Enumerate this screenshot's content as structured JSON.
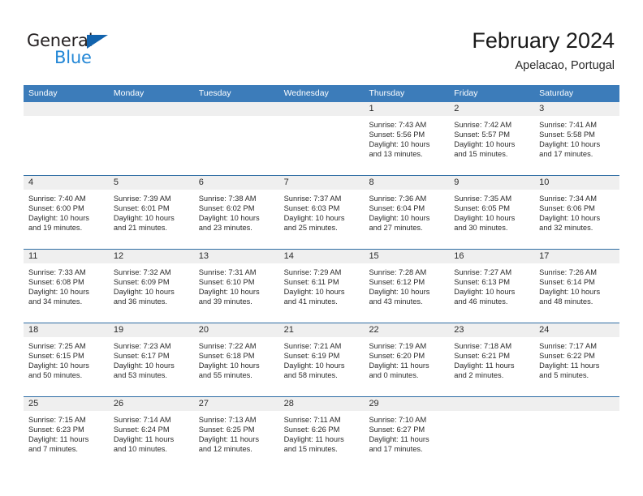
{
  "brand": {
    "name_top": "General",
    "name_bottom": "Blue"
  },
  "header": {
    "title": "February 2024",
    "subtitle": "Apelacao, Portugal"
  },
  "calendar": {
    "weekday_headers": [
      "Sunday",
      "Monday",
      "Tuesday",
      "Wednesday",
      "Thursday",
      "Friday",
      "Saturday"
    ],
    "colors": {
      "header_blue": "#3c7cba",
      "week_divider": "#2e6da4",
      "daynum_band": "#efefef",
      "brand_blue": "#2387d6",
      "brand_triangle": "#1263ad"
    },
    "weeks": [
      [
        {
          "day": "",
          "empty": true,
          "lines": []
        },
        {
          "day": "",
          "empty": true,
          "lines": []
        },
        {
          "day": "",
          "empty": true,
          "lines": []
        },
        {
          "day": "",
          "empty": true,
          "lines": []
        },
        {
          "day": "1",
          "empty": false,
          "lines": [
            "Sunrise: 7:43 AM",
            "Sunset: 5:56 PM",
            "Daylight: 10 hours",
            "and 13 minutes."
          ]
        },
        {
          "day": "2",
          "empty": false,
          "lines": [
            "Sunrise: 7:42 AM",
            "Sunset: 5:57 PM",
            "Daylight: 10 hours",
            "and 15 minutes."
          ]
        },
        {
          "day": "3",
          "empty": false,
          "lines": [
            "Sunrise: 7:41 AM",
            "Sunset: 5:58 PM",
            "Daylight: 10 hours",
            "and 17 minutes."
          ]
        }
      ],
      [
        {
          "day": "4",
          "empty": false,
          "lines": [
            "Sunrise: 7:40 AM",
            "Sunset: 6:00 PM",
            "Daylight: 10 hours",
            "and 19 minutes."
          ]
        },
        {
          "day": "5",
          "empty": false,
          "lines": [
            "Sunrise: 7:39 AM",
            "Sunset: 6:01 PM",
            "Daylight: 10 hours",
            "and 21 minutes."
          ]
        },
        {
          "day": "6",
          "empty": false,
          "lines": [
            "Sunrise: 7:38 AM",
            "Sunset: 6:02 PM",
            "Daylight: 10 hours",
            "and 23 minutes."
          ]
        },
        {
          "day": "7",
          "empty": false,
          "lines": [
            "Sunrise: 7:37 AM",
            "Sunset: 6:03 PM",
            "Daylight: 10 hours",
            "and 25 minutes."
          ]
        },
        {
          "day": "8",
          "empty": false,
          "lines": [
            "Sunrise: 7:36 AM",
            "Sunset: 6:04 PM",
            "Daylight: 10 hours",
            "and 27 minutes."
          ]
        },
        {
          "day": "9",
          "empty": false,
          "lines": [
            "Sunrise: 7:35 AM",
            "Sunset: 6:05 PM",
            "Daylight: 10 hours",
            "and 30 minutes."
          ]
        },
        {
          "day": "10",
          "empty": false,
          "lines": [
            "Sunrise: 7:34 AM",
            "Sunset: 6:06 PM",
            "Daylight: 10 hours",
            "and 32 minutes."
          ]
        }
      ],
      [
        {
          "day": "11",
          "empty": false,
          "lines": [
            "Sunrise: 7:33 AM",
            "Sunset: 6:08 PM",
            "Daylight: 10 hours",
            "and 34 minutes."
          ]
        },
        {
          "day": "12",
          "empty": false,
          "lines": [
            "Sunrise: 7:32 AM",
            "Sunset: 6:09 PM",
            "Daylight: 10 hours",
            "and 36 minutes."
          ]
        },
        {
          "day": "13",
          "empty": false,
          "lines": [
            "Sunrise: 7:31 AM",
            "Sunset: 6:10 PM",
            "Daylight: 10 hours",
            "and 39 minutes."
          ]
        },
        {
          "day": "14",
          "empty": false,
          "lines": [
            "Sunrise: 7:29 AM",
            "Sunset: 6:11 PM",
            "Daylight: 10 hours",
            "and 41 minutes."
          ]
        },
        {
          "day": "15",
          "empty": false,
          "lines": [
            "Sunrise: 7:28 AM",
            "Sunset: 6:12 PM",
            "Daylight: 10 hours",
            "and 43 minutes."
          ]
        },
        {
          "day": "16",
          "empty": false,
          "lines": [
            "Sunrise: 7:27 AM",
            "Sunset: 6:13 PM",
            "Daylight: 10 hours",
            "and 46 minutes."
          ]
        },
        {
          "day": "17",
          "empty": false,
          "lines": [
            "Sunrise: 7:26 AM",
            "Sunset: 6:14 PM",
            "Daylight: 10 hours",
            "and 48 minutes."
          ]
        }
      ],
      [
        {
          "day": "18",
          "empty": false,
          "lines": [
            "Sunrise: 7:25 AM",
            "Sunset: 6:15 PM",
            "Daylight: 10 hours",
            "and 50 minutes."
          ]
        },
        {
          "day": "19",
          "empty": false,
          "lines": [
            "Sunrise: 7:23 AM",
            "Sunset: 6:17 PM",
            "Daylight: 10 hours",
            "and 53 minutes."
          ]
        },
        {
          "day": "20",
          "empty": false,
          "lines": [
            "Sunrise: 7:22 AM",
            "Sunset: 6:18 PM",
            "Daylight: 10 hours",
            "and 55 minutes."
          ]
        },
        {
          "day": "21",
          "empty": false,
          "lines": [
            "Sunrise: 7:21 AM",
            "Sunset: 6:19 PM",
            "Daylight: 10 hours",
            "and 58 minutes."
          ]
        },
        {
          "day": "22",
          "empty": false,
          "lines": [
            "Sunrise: 7:19 AM",
            "Sunset: 6:20 PM",
            "Daylight: 11 hours",
            "and 0 minutes."
          ]
        },
        {
          "day": "23",
          "empty": false,
          "lines": [
            "Sunrise: 7:18 AM",
            "Sunset: 6:21 PM",
            "Daylight: 11 hours",
            "and 2 minutes."
          ]
        },
        {
          "day": "24",
          "empty": false,
          "lines": [
            "Sunrise: 7:17 AM",
            "Sunset: 6:22 PM",
            "Daylight: 11 hours",
            "and 5 minutes."
          ]
        }
      ],
      [
        {
          "day": "25",
          "empty": false,
          "lines": [
            "Sunrise: 7:15 AM",
            "Sunset: 6:23 PM",
            "Daylight: 11 hours",
            "and 7 minutes."
          ]
        },
        {
          "day": "26",
          "empty": false,
          "lines": [
            "Sunrise: 7:14 AM",
            "Sunset: 6:24 PM",
            "Daylight: 11 hours",
            "and 10 minutes."
          ]
        },
        {
          "day": "27",
          "empty": false,
          "lines": [
            "Sunrise: 7:13 AM",
            "Sunset: 6:25 PM",
            "Daylight: 11 hours",
            "and 12 minutes."
          ]
        },
        {
          "day": "28",
          "empty": false,
          "lines": [
            "Sunrise: 7:11 AM",
            "Sunset: 6:26 PM",
            "Daylight: 11 hours",
            "and 15 minutes."
          ]
        },
        {
          "day": "29",
          "empty": false,
          "lines": [
            "Sunrise: 7:10 AM",
            "Sunset: 6:27 PM",
            "Daylight: 11 hours",
            "and 17 minutes."
          ]
        },
        {
          "day": "",
          "empty": true,
          "lines": []
        },
        {
          "day": "",
          "empty": true,
          "lines": []
        }
      ]
    ]
  }
}
